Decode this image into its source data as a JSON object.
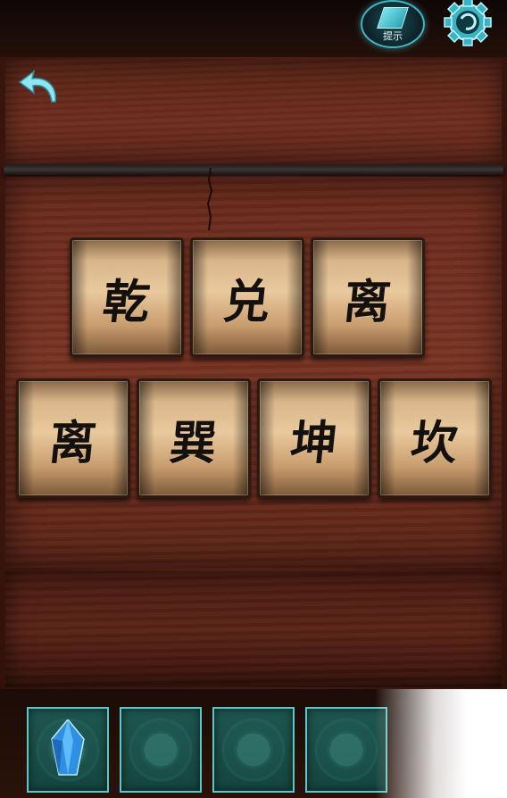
{
  "header": {
    "back_icon": "back-arrow-icon",
    "hint_label": "提示",
    "hint_icon": "hint-book-icon",
    "settings_icon": "gear-icon"
  },
  "puzzle": {
    "row1": [
      {
        "char": "乾"
      },
      {
        "char": "兑"
      },
      {
        "char": "离"
      }
    ],
    "row2": [
      {
        "char": "离"
      },
      {
        "char": "巽"
      },
      {
        "char": "坤"
      },
      {
        "char": "坎"
      }
    ]
  },
  "inventory": {
    "slots": [
      {
        "item": "blue-crystal-icon"
      },
      {
        "item": "empty"
      },
      {
        "item": "empty"
      },
      {
        "item": "empty"
      }
    ]
  },
  "colors": {
    "accent": "#3fb4c4",
    "wood": "#6e2e1e",
    "tile": "#d9b58a",
    "slot_border": "#5cc8c8"
  }
}
